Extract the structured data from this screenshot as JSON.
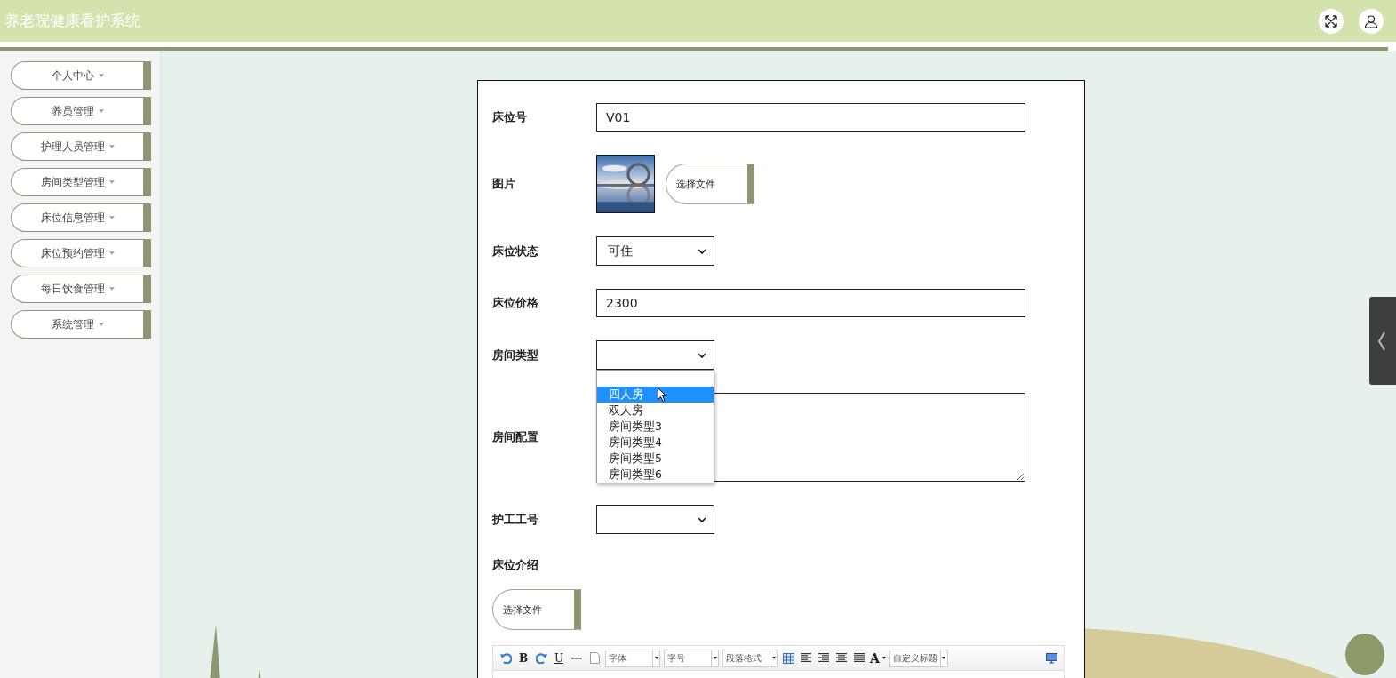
{
  "header": {
    "title": "养老院健康看护系统"
  },
  "sidebar": {
    "items": [
      {
        "label": "个人中心"
      },
      {
        "label": "养员管理"
      },
      {
        "label": "护理人员管理"
      },
      {
        "label": "房间类型管理"
      },
      {
        "label": "床位信息管理"
      },
      {
        "label": "床位预约管理"
      },
      {
        "label": "每日饮食管理"
      },
      {
        "label": "系统管理"
      }
    ]
  },
  "form": {
    "fields": [
      {
        "kind": "text",
        "label": "床位号",
        "value": "V01"
      },
      {
        "label": "图片",
        "button": "选择文件"
      },
      {
        "kind": "select",
        "label": "床位状态",
        "value": "可住"
      },
      {
        "kind": "text",
        "label": "床位价格",
        "value": "2300"
      },
      {
        "kind": "select",
        "label": "房间类型",
        "open": true,
        "options": [
          {
            "label": "四人房",
            "selected": true
          },
          {
            "label": "双人房",
            "selected": false
          },
          {
            "label": "房间类型3",
            "selected": false
          },
          {
            "label": "房间类型4",
            "selected": false
          },
          {
            "label": "房间类型5",
            "selected": false
          },
          {
            "label": "房间类型6",
            "selected": false
          }
        ]
      },
      {
        "kind": "textarea",
        "label": "房间配置"
      },
      {
        "kind": "select",
        "label": "护工工号"
      },
      {
        "kind": "editor",
        "label": "床位介绍",
        "button": "选择文件",
        "toolbar": [
          {
            "kind": "undo"
          },
          {
            "kind": "bold",
            "text": "B"
          },
          {
            "kind": "redo"
          },
          {
            "kind": "underline",
            "text": "U"
          },
          {
            "kind": "hr"
          },
          {
            "kind": "doc"
          },
          {
            "kind": "select",
            "text": "字体"
          },
          {
            "kind": "select",
            "text": "字号"
          },
          {
            "kind": "select",
            "text": "段落格式"
          },
          {
            "kind": "table"
          },
          {
            "kind": "align-left"
          },
          {
            "kind": "align-right"
          },
          {
            "kind": "align-center"
          },
          {
            "kind": "justify"
          },
          {
            "kind": "color",
            "text": "A"
          },
          {
            "kind": "select",
            "text": "自定义标题"
          },
          {
            "kind": "preview"
          }
        ]
      }
    ]
  }
}
